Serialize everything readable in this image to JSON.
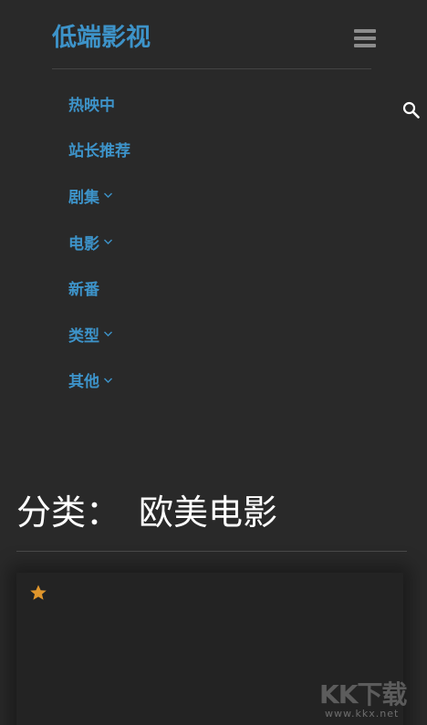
{
  "header": {
    "logo_text": "低端影视",
    "menu_icon": "hamburger-menu-icon",
    "search_icon": "search-icon"
  },
  "nav": {
    "items": [
      {
        "label": "热映中",
        "has_dropdown": false
      },
      {
        "label": "站长推荐",
        "has_dropdown": false
      },
      {
        "label": "剧集",
        "has_dropdown": true
      },
      {
        "label": "电影",
        "has_dropdown": true
      },
      {
        "label": "新番",
        "has_dropdown": false
      },
      {
        "label": "类型",
        "has_dropdown": true
      },
      {
        "label": "其他",
        "has_dropdown": true
      }
    ]
  },
  "category": {
    "prefix": "分类：",
    "name": "欧美电影"
  },
  "card": {
    "badge_icon": "star-icon"
  },
  "watermark": {
    "main": "KK下载",
    "sub": "www.kkx.net"
  },
  "colors": {
    "background": "#292929",
    "accent": "#3d93c9",
    "title_text": "#ffffff",
    "star": "#e0962c",
    "menu_icon": "#8c8c8c"
  }
}
